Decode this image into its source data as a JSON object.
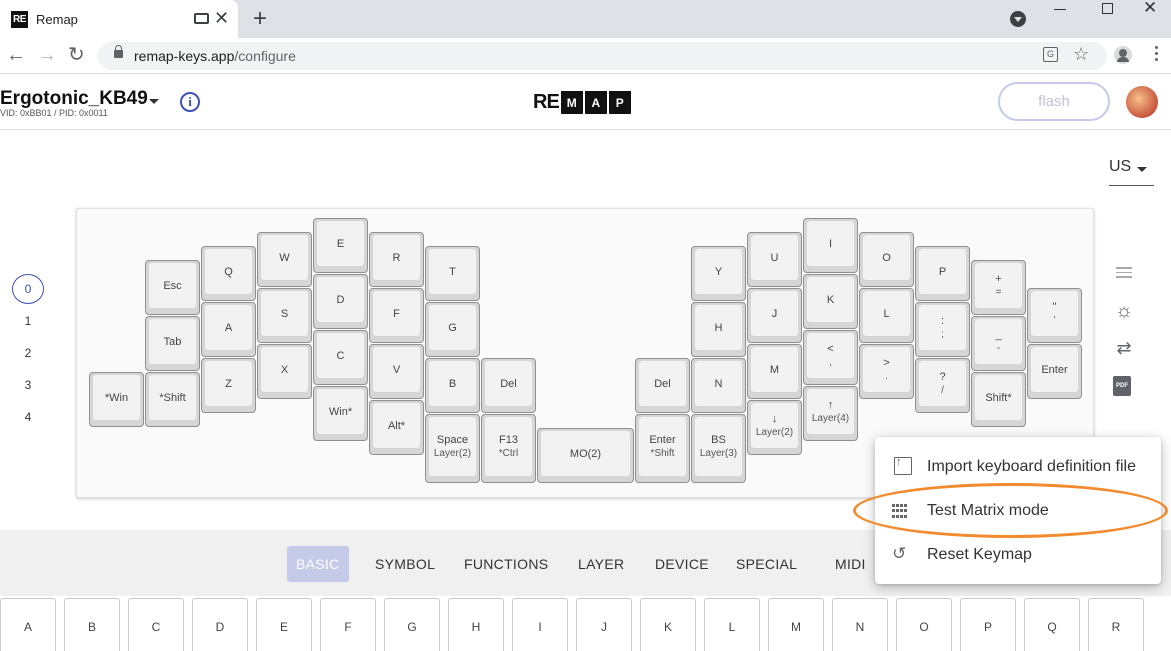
{
  "browser": {
    "tab_title": "Remap",
    "favicon_text": "RE",
    "url_host": "remap-keys.app",
    "url_path": "/configure"
  },
  "header": {
    "keyboard_name": "Ergotonic_KB49",
    "ids": "VID: 0xBB01 / PID: 0x0011",
    "logo_prefix": "RE",
    "logo_boxes": [
      "M",
      "A",
      "P"
    ],
    "flash_label": "flash"
  },
  "layout_selector": {
    "value": "US"
  },
  "layers": [
    {
      "label": "0",
      "active": true
    },
    {
      "label": "1",
      "active": false
    },
    {
      "label": "2",
      "active": false
    },
    {
      "label": "3",
      "active": false
    },
    {
      "label": "4",
      "active": false
    }
  ],
  "keys": {
    "esc": {
      "main": "Esc"
    },
    "tab": {
      "main": "Tab"
    },
    "win": {
      "main": "*Win"
    },
    "shift_l": {
      "main": "*Shift"
    },
    "q": {
      "main": "Q"
    },
    "a": {
      "main": "A"
    },
    "z": {
      "main": "Z"
    },
    "w": {
      "main": "W"
    },
    "s": {
      "main": "S"
    },
    "x": {
      "main": "X"
    },
    "e": {
      "main": "E"
    },
    "d": {
      "main": "D"
    },
    "c": {
      "main": "C"
    },
    "win2": {
      "main": "Win*"
    },
    "r": {
      "main": "R"
    },
    "f": {
      "main": "F"
    },
    "v": {
      "main": "V"
    },
    "alt": {
      "main": "Alt*"
    },
    "t": {
      "main": "T"
    },
    "g": {
      "main": "G"
    },
    "b": {
      "main": "B"
    },
    "space": {
      "main": "Space",
      "sub": "Layer(2)"
    },
    "del_l": {
      "main": "Del"
    },
    "f13": {
      "main": "F13",
      "sub": "*Ctrl"
    },
    "mo2": {
      "main": "MO(2)"
    },
    "del_r": {
      "main": "Del"
    },
    "enter_l": {
      "main": "Enter",
      "sub": "*Shift"
    },
    "y": {
      "main": "Y"
    },
    "h": {
      "main": "H"
    },
    "n": {
      "main": "N"
    },
    "bs": {
      "main": "BS",
      "sub": "Layer(3)"
    },
    "u": {
      "main": "U"
    },
    "j": {
      "main": "J"
    },
    "m": {
      "main": "M"
    },
    "down": {
      "main": "↓",
      "sub": "Layer(2)"
    },
    "i": {
      "main": "I"
    },
    "k": {
      "main": "K"
    },
    "comma": {
      "main": "<",
      "sub": ","
    },
    "up": {
      "main": "↑",
      "sub": "Layer(4)"
    },
    "o": {
      "main": "O"
    },
    "l": {
      "main": "L"
    },
    "period": {
      "main": ">",
      "sub": "."
    },
    "p": {
      "main": "P"
    },
    "semicolon": {
      "main": ":",
      "sub": ";"
    },
    "slash": {
      "main": "?",
      "sub": "/"
    },
    "plus": {
      "main": "+",
      "sub": "="
    },
    "minus": {
      "main": "_",
      "sub": "-"
    },
    "shift_r": {
      "main": "Shift*"
    },
    "quote": {
      "main": "\"",
      "sub": "'"
    },
    "enter_r": {
      "main": "Enter"
    }
  },
  "categories": [
    "BASIC",
    "SYMBOL",
    "FUNCTIONS",
    "LAYER",
    "DEVICE",
    "SPECIAL",
    "MIDI"
  ],
  "active_category": "BASIC",
  "keypad": [
    "A",
    "B",
    "C",
    "D",
    "E",
    "F",
    "G",
    "H",
    "I",
    "J",
    "K",
    "L",
    "M",
    "N",
    "O",
    "P",
    "Q",
    "R"
  ],
  "popup_menu": {
    "items": [
      {
        "label": "Import keyboard definition file",
        "icon": "import-file-icon"
      },
      {
        "label": "Test Matrix mode",
        "icon": "grid-icon"
      },
      {
        "label": "Reset Keymap",
        "icon": "history-icon"
      }
    ]
  },
  "colors": {
    "accent": "#3f51b5",
    "highlight": "#f28a2e",
    "active_tab": "#c5cae9"
  }
}
